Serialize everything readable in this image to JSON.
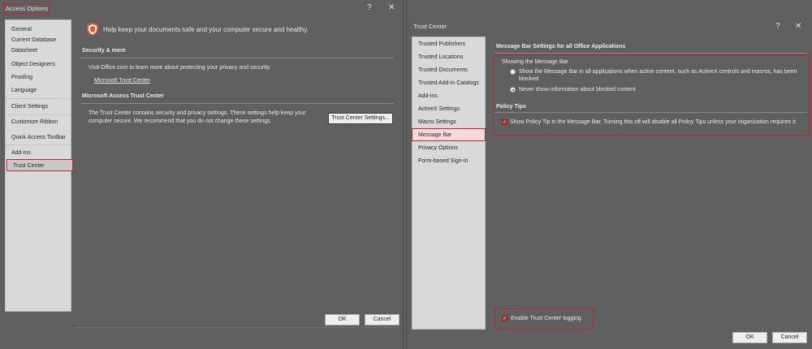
{
  "access_options": {
    "title": "Access Options",
    "help_glyph": "?",
    "close_glyph": "✕",
    "sidebar": {
      "items": [
        {
          "label": "General"
        },
        {
          "label": "Current Database"
        },
        {
          "label": "Datasheet"
        },
        {
          "label": "Object Designers"
        },
        {
          "label": "Proofing"
        },
        {
          "label": "Language"
        },
        {
          "label": "Client Settings"
        },
        {
          "label": "Customize Ribbon"
        },
        {
          "label": "Quick Access Toolbar"
        },
        {
          "label": "Add-ins"
        },
        {
          "label": "Trust Center"
        }
      ],
      "selected": "Trust Center"
    },
    "header_text": "Help keep your documents safe and your computer secure and healthy.",
    "security_more": {
      "heading": "Security & more",
      "body": "Visit Office.com to learn more about protecting your privacy and security.",
      "link": "Microsoft Trust Center"
    },
    "trust_center": {
      "heading": "Microsoft Access Trust Center",
      "body": "The Trust Center contains security and privacy settings. These settings help keep your computer secure. We recommend that you do not change these settings.",
      "settings_button": "Trust Center Settings..."
    },
    "ok_label": "OK",
    "cancel_label": "Cancel",
    "accent_color": "#c0262b"
  },
  "trust_center_dialog": {
    "title": "Trust Center",
    "help_glyph": "?",
    "close_glyph": "✕",
    "sidebar": {
      "items": [
        {
          "label": "Trusted Publishers"
        },
        {
          "label": "Trusted Locations"
        },
        {
          "label": "Trusted Documents"
        },
        {
          "label": "Trusted Add-in Catalogs"
        },
        {
          "label": "Add-ins"
        },
        {
          "label": "ActiveX Settings"
        },
        {
          "label": "Macro Settings"
        },
        {
          "label": "Message Bar"
        },
        {
          "label": "Privacy Options"
        },
        {
          "label": "Form-based Sign-in"
        }
      ],
      "selected": "Message Bar"
    },
    "section_title": "Message Bar Settings for all Office Applications",
    "showing_label": "Showing the Message Bar",
    "radio_show": {
      "label_line1": "Show the Message Bar in all applications when active content, such as ActiveX controls and macros, has been",
      "label_line2": "blocked",
      "checked": false
    },
    "radio_never": {
      "label": "Never show information about blocked content",
      "checked": true
    },
    "policy_tips": {
      "heading": "Policy Tips",
      "checkbox_label": "Show Policy Tip in the Message Bar. Turning this off will disable all Policy Tips unless your organization requires it.",
      "checked": true
    },
    "logging": {
      "checkbox_label": "Enable Trust Center logging",
      "checked": true
    },
    "ok_label": "OK",
    "cancel_label": "Cancel"
  }
}
